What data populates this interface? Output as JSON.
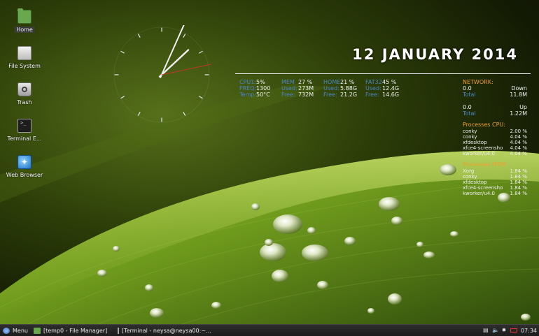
{
  "desktop_icons": [
    {
      "label": "Home",
      "icon": "folder-home-icon"
    },
    {
      "label": "File System",
      "icon": "drive-icon"
    },
    {
      "label": "Trash",
      "icon": "trash-icon"
    },
    {
      "label": "Terminal E...",
      "icon": "terminal-icon"
    },
    {
      "label": "Web Browser",
      "icon": "web-browser-icon"
    }
  ],
  "clock": {
    "time": "07:34"
  },
  "conky": {
    "date": "12 JANUARY 2014",
    "cpu": [
      {
        "key": "CPU1:",
        "value": "5%"
      },
      {
        "key": "FREQ:",
        "value": "1300"
      },
      {
        "key": "Temp:",
        "value": "50°C"
      }
    ],
    "mem": [
      {
        "key": "MEM",
        "value": "27 %"
      },
      {
        "key": "Used:",
        "value": "273M"
      },
      {
        "key": "Free:",
        "value": "732M"
      }
    ],
    "home": [
      {
        "key": "HOME",
        "value": "21 %"
      },
      {
        "key": "Used:",
        "value": "5.88G"
      },
      {
        "key": "Free:",
        "value": "21.2G"
      }
    ],
    "fat32": [
      {
        "key": "FAT32",
        "value": "45 %"
      },
      {
        "key": "Used:",
        "value": "12.4G"
      },
      {
        "key": "Free:",
        "value": "14.6G"
      }
    ],
    "network": {
      "title": "NETWORK:",
      "down_rate": "0.0",
      "down_label": "Down",
      "down_total_label": "Total",
      "down_total": "11.8M",
      "up_rate": "0.0",
      "up_label": "Up",
      "up_total_label": "Total",
      "up_total": "1.22M"
    },
    "processes_cpu": {
      "title": "Processes CPU:",
      "rows": [
        {
          "name": "conky",
          "value": "2.00 %"
        },
        {
          "name": "conky",
          "value": "4.04 %"
        },
        {
          "name": "xfdesktop",
          "value": "4.04 %"
        },
        {
          "name": "xfce4-screensho",
          "value": "4.04 %"
        },
        {
          "name": "kworker/u4:0",
          "value": "4.04 %"
        }
      ]
    },
    "processes_mem": {
      "title": "Processes MEM:",
      "rows": [
        {
          "name": "Xorg",
          "value": "1.84 %"
        },
        {
          "name": "conky",
          "value": "1.84 %"
        },
        {
          "name": "xfdesktop",
          "value": "1.84 %"
        },
        {
          "name": "xfce4-screensho",
          "value": "1.84 %"
        },
        {
          "name": "kworker/u4:0",
          "value": "1.84 %"
        }
      ]
    }
  },
  "taskbar": {
    "menu_label": "Menu",
    "tasks": [
      {
        "label": "[temp0 - File Manager]",
        "icon": "file-manager-icon"
      },
      {
        "label": "[Terminal - neysa@neysa00:~...",
        "icon": "terminal-icon"
      }
    ],
    "tray_icons": [
      "network-icon",
      "volume-icon",
      "settings-icon",
      "battery-icon"
    ],
    "time": "07:34"
  },
  "colors": {
    "conky_key_blue": "#4a86c5",
    "conky_heading_orange": "#f0a030",
    "clock_second_hand": "#c0392b",
    "battery_red": "#e33333"
  }
}
